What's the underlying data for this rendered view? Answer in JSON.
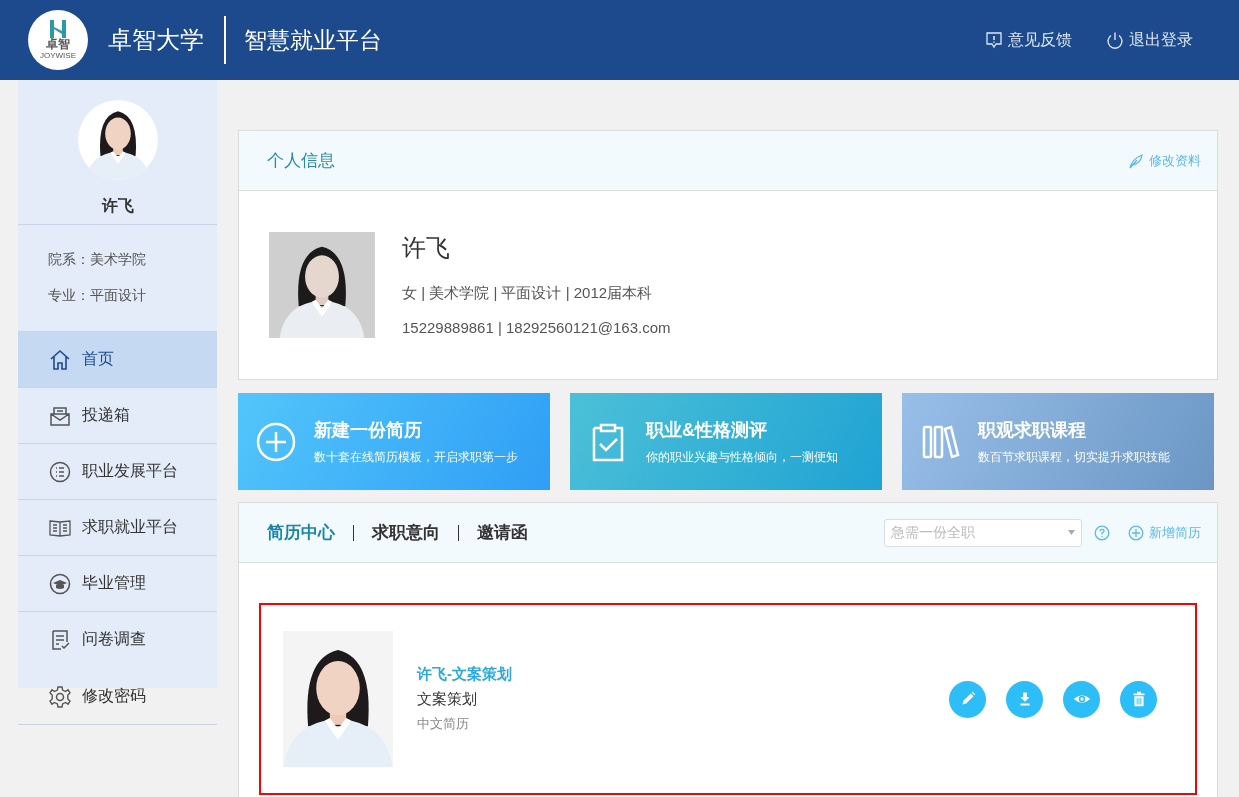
{
  "header": {
    "logo": {
      "mark": "卓智",
      "wordmark": "JOYWISE"
    },
    "school": "卓智大学",
    "platform": "智慧就业平台",
    "actions": [
      "意见反馈",
      "退出登录"
    ]
  },
  "sidebar": {
    "user": {
      "name": "许飞"
    },
    "details": [
      "院系：美术学院",
      "专业：平面设计"
    ],
    "items": [
      {
        "label": "首页",
        "selected": true
      },
      {
        "label": "投递箱",
        "selected": false
      },
      {
        "label": "职业发展平台",
        "selected": false
      },
      {
        "label": "求职就业平台",
        "selected": false
      },
      {
        "label": "毕业管理",
        "selected": false
      },
      {
        "label": "问卷调查",
        "selected": false
      },
      {
        "label": "修改密码",
        "selected": false
      }
    ]
  },
  "profile": {
    "title": "个人信息",
    "edit_link": "修改资料",
    "name": "许飞",
    "summary": "女 | 美术学院 | 平面设计 | 2012届本科",
    "contact": "15229889861 | 18292560121@163.com"
  },
  "tiles": [
    {
      "title": "新建一份简历",
      "subtitle": "数十套在线简历模板，开启求职第一步"
    },
    {
      "title": "职业&性格测评",
      "subtitle": "你的职业兴趣与性格倾向，一测便知"
    },
    {
      "title": "职观求职课程",
      "subtitle": "数百节求职课程，切实提升求职技能"
    }
  ],
  "resume_center": {
    "tabs": [
      {
        "label": "简历中心",
        "selected": true
      },
      {
        "label": "求职意向",
        "selected": false
      },
      {
        "label": "邀请函",
        "selected": false
      }
    ],
    "select": {
      "placeholder": "急需一份全职"
    },
    "add_link": "新增简历",
    "resumes": [
      {
        "title": "许飞-文案策划",
        "position": "文案策划",
        "language": "中文简历",
        "highlighted": true
      }
    ]
  }
}
